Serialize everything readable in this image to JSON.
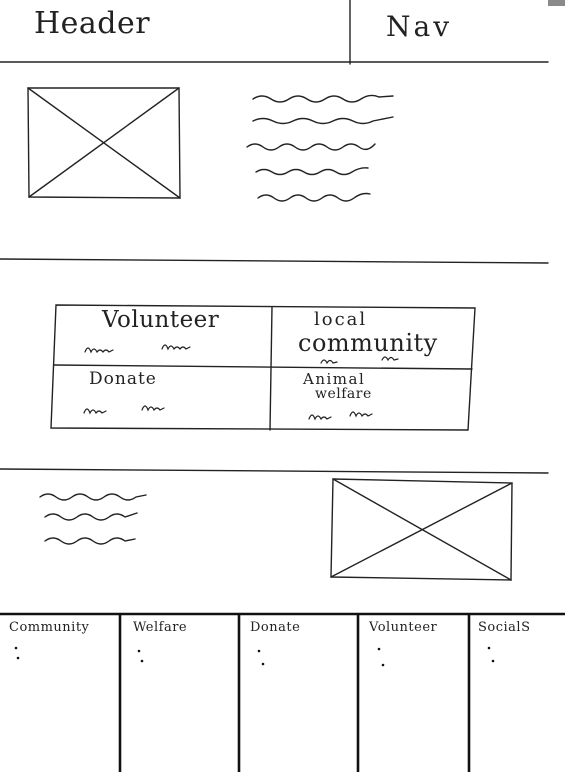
{
  "header": {
    "label": "Header",
    "nav": "Nav"
  },
  "categories": [
    {
      "label": "Volunteer"
    },
    {
      "line1": "local",
      "line2": "community"
    },
    {
      "label": "Donate"
    },
    {
      "line1": "Animal",
      "line2": "welfare"
    }
  ],
  "footer": [
    "Community",
    "Welfare",
    "Donate",
    "Volunteer",
    "SocialS"
  ],
  "colors": {
    "ink": "#222222",
    "paper": "#ffffff",
    "corner_mark": "#8a8a8a"
  },
  "icons": [
    "image-placeholder-icon",
    "bullet-dot-icon"
  ]
}
